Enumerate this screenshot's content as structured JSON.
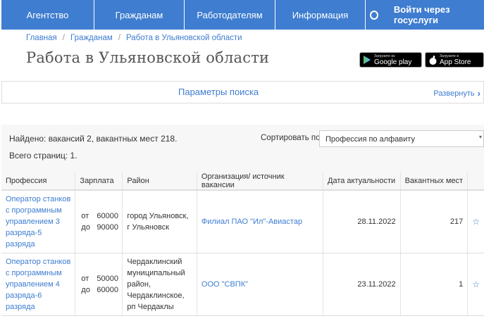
{
  "nav": {
    "items": [
      "Агентство",
      "Гражданам",
      "Работодателям",
      "Информация"
    ],
    "login_label": "Войти через госуслуги"
  },
  "breadcrumb": [
    "Главная",
    "Гражданам",
    "Работа в Ульяновской области"
  ],
  "page_title": "Работа в Ульяновской области",
  "badges": {
    "google": {
      "small": "Загрузите из",
      "big": "Google play"
    },
    "apple": {
      "small": "Загрузите в",
      "big": "App Store"
    }
  },
  "search_params": {
    "title": "Параметры поиска",
    "expand_label": "Развернуть"
  },
  "results": {
    "found_text": "Найдено: вакансий 2, вакантных мест 218.",
    "pages_text": "Всего страниц: 1.",
    "sort_label": "Сортировать по:",
    "sort_value": "Профессия по алфавиту"
  },
  "table": {
    "headers": [
      "Профессия",
      "Зарплата",
      "Район",
      "Организация/ источник вакансии",
      "Дата актуальности",
      "Вакантных мест"
    ],
    "rows": [
      {
        "profession": "Оператор станков с программным управлением 3 разряда-5 разряда",
        "salary_from_label": "от",
        "salary_from": "60000",
        "salary_to_label": "до",
        "salary_to": "90000",
        "district": "город Ульяновск, г Ульяновск",
        "org": "Филиал ПАО \"Ил\"-Авиастар",
        "date": "28.11.2022",
        "vacancies": "217"
      },
      {
        "profession": "Оператор станков с программным управлением 4 разряда-6 разряда",
        "salary_from_label": "от",
        "salary_from": "50000",
        "salary_to_label": "до",
        "salary_to": "60000",
        "district": "Чердаклинский муниципальный район, Чердаклинское, рп Чердаклы",
        "org": "ООО \"СВПК\"",
        "date": "23.11.2022",
        "vacancies": "1"
      }
    ]
  },
  "icons": {
    "favorite": "star-icon",
    "expand": "chevron-right-icon",
    "login": "circle-icon",
    "google": "play-icon",
    "apple": "apple-icon"
  },
  "colors": {
    "accent": "#3e7dd0"
  }
}
